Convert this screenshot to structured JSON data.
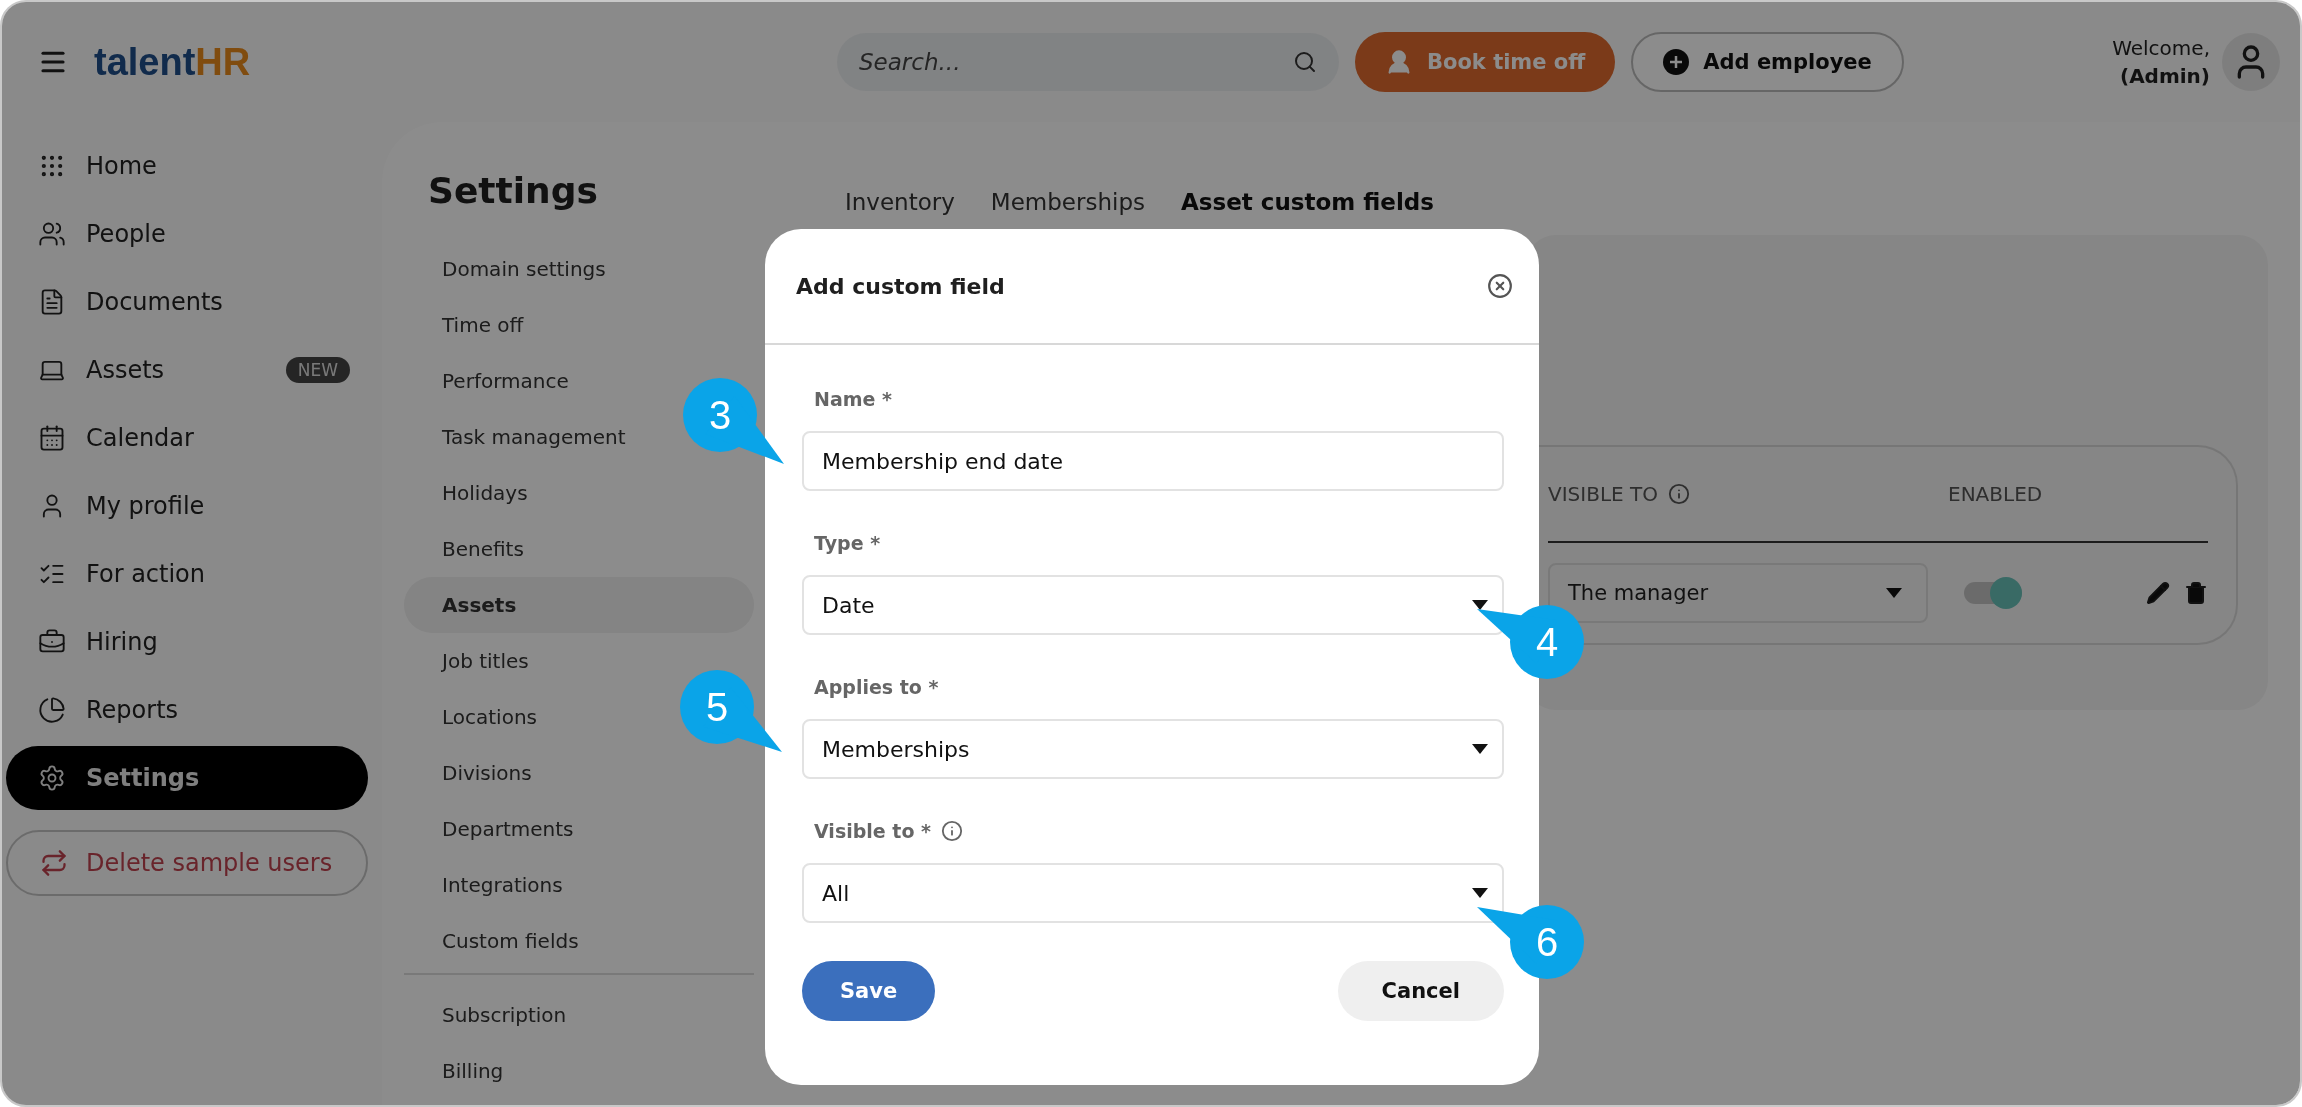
{
  "topbar": {
    "logo": {
      "text": "talent",
      "accent": "HR"
    },
    "search": {
      "placeholder": "Search..."
    },
    "book_button": "Book time off",
    "add_button": "Add employee",
    "welcome": "Welcome,",
    "role": "(Admin)"
  },
  "sidebar": {
    "items": [
      {
        "label": "Home",
        "selected": false
      },
      {
        "label": "People",
        "selected": false
      },
      {
        "label": "Documents",
        "selected": false
      },
      {
        "label": "Assets",
        "selected": false,
        "badge": "NEW"
      },
      {
        "label": "Calendar",
        "selected": false
      },
      {
        "label": "My profile",
        "selected": false
      },
      {
        "label": "For action",
        "selected": false
      },
      {
        "label": "Hiring",
        "selected": false
      },
      {
        "label": "Reports",
        "selected": false
      },
      {
        "label": "Settings",
        "selected": true
      }
    ],
    "delete_button": "Delete sample users"
  },
  "settings": {
    "title": "Settings",
    "menu": [
      {
        "label": "Domain settings",
        "selected": false
      },
      {
        "label": "Time off",
        "selected": false
      },
      {
        "label": "Performance",
        "selected": false
      },
      {
        "label": "Task management",
        "selected": false
      },
      {
        "label": "Holidays",
        "selected": false
      },
      {
        "label": "Benefits",
        "selected": false
      },
      {
        "label": "Assets",
        "selected": true
      },
      {
        "label": "Job titles",
        "selected": false
      },
      {
        "label": "Locations",
        "selected": false
      },
      {
        "label": "Divisions",
        "selected": false
      },
      {
        "label": "Departments",
        "selected": false
      },
      {
        "label": "Integrations",
        "selected": false
      },
      {
        "label": "Custom fields",
        "selected": false
      }
    ],
    "menu_bottom": [
      "Subscription",
      "Billing"
    ]
  },
  "tabs": [
    {
      "label": "Inventory",
      "selected": false
    },
    {
      "label": "Memberships",
      "selected": false
    },
    {
      "label": "Asset custom fields",
      "selected": true
    }
  ],
  "table": {
    "columns": [
      "VISIBLE TO",
      "ENABLED"
    ],
    "row": {
      "visible_to": "The manager",
      "enabled": true
    }
  },
  "modal": {
    "title": "Add custom field",
    "fields": [
      {
        "label": "Name *",
        "kind": "text",
        "value": "Membership end date"
      },
      {
        "label": "Type *",
        "kind": "select",
        "value": "Date"
      },
      {
        "label": "Applies to *",
        "kind": "select",
        "value": "Memberships"
      },
      {
        "label": "Visible to *",
        "kind": "select",
        "value": "All",
        "info": true
      }
    ],
    "save": "Save",
    "cancel": "Cancel"
  },
  "callouts": [
    {
      "label": "3"
    },
    {
      "label": "4"
    },
    {
      "label": "5"
    },
    {
      "label": "6"
    }
  ]
}
